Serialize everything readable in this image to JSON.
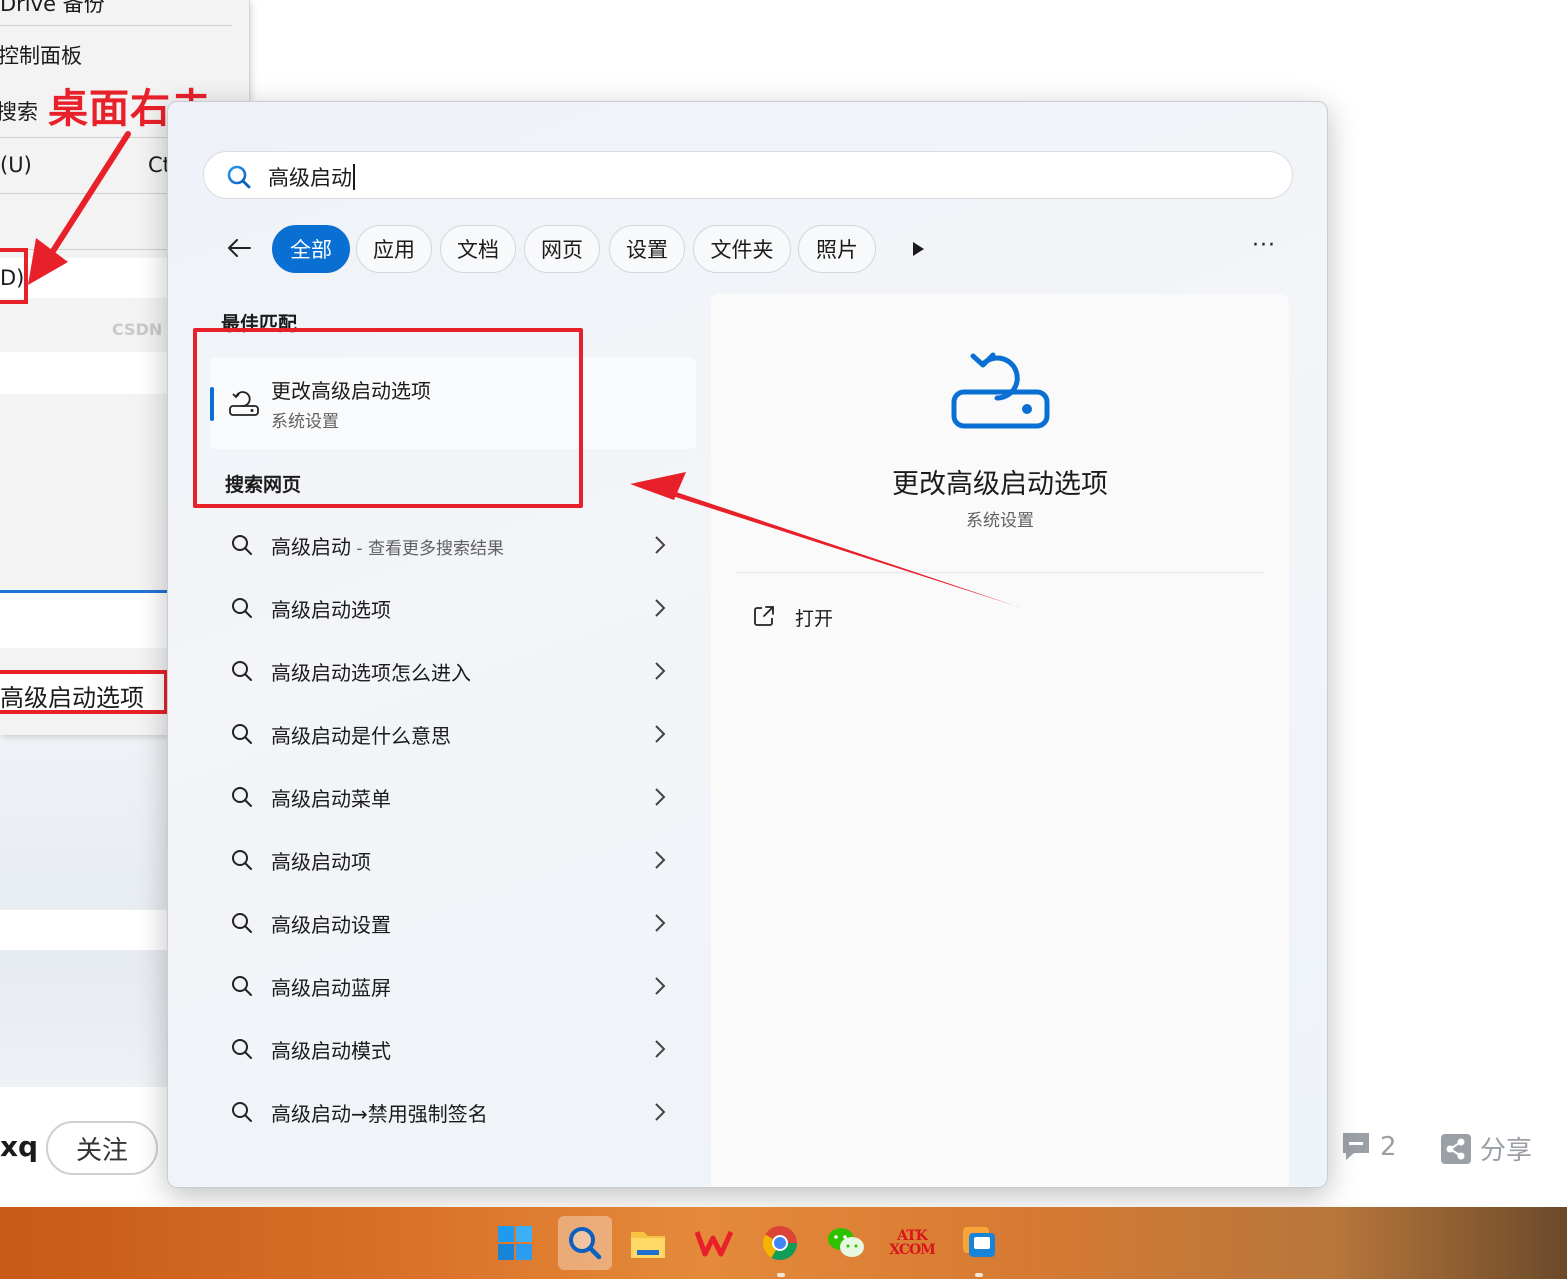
{
  "background": {
    "menu_items": {
      "drive": "Drive 备份",
      "control_panel": "控制面板",
      "search": "搜索",
      "u_item": "(U)",
      "u_shortcut": "Ct",
      "d_item": "D)",
      "highlighted": "高级启动选项"
    },
    "annotation_text": "桌面右击",
    "watermark": "CSDN",
    "author_suffix": "xq",
    "follow_label": "关注",
    "comment_count": "2",
    "share_label": "分享"
  },
  "search": {
    "query": "高级启动",
    "filters": [
      {
        "label": "全部",
        "active": true
      },
      {
        "label": "应用",
        "active": false
      },
      {
        "label": "文档",
        "active": false
      },
      {
        "label": "网页",
        "active": false
      },
      {
        "label": "设置",
        "active": false
      },
      {
        "label": "文件夹",
        "active": false
      },
      {
        "label": "照片",
        "active": false
      }
    ],
    "more_label": "···",
    "best_match_heading": "最佳匹配",
    "best_match": {
      "title": "更改高级启动选项",
      "subtitle": "系统设置"
    },
    "web_heading": "搜索网页",
    "web_results": [
      {
        "text": "高级启动",
        "hint": " - 查看更多搜索结果"
      },
      {
        "text": "高级启动选项",
        "hint": ""
      },
      {
        "text": "高级启动选项怎么进入",
        "hint": ""
      },
      {
        "text": "高级启动是什么意思",
        "hint": ""
      },
      {
        "text": "高级启动菜单",
        "hint": ""
      },
      {
        "text": "高级启动项",
        "hint": ""
      },
      {
        "text": "高级启动设置",
        "hint": ""
      },
      {
        "text": "高级启动蓝屏",
        "hint": ""
      },
      {
        "text": "高级启动模式",
        "hint": ""
      },
      {
        "text": "高级启动→禁用强制签名",
        "hint": ""
      }
    ],
    "preview": {
      "title": "更改高级启动选项",
      "subtitle": "系统设置",
      "open_label": "打开"
    }
  },
  "colors": {
    "accent": "#0a6fd2",
    "annotation": "#e8202a"
  },
  "taskbar": {
    "icons": [
      "windows-start-icon",
      "search-icon",
      "file-explorer-icon",
      "wps-icon",
      "chrome-icon",
      "wechat-icon",
      "atk-xcom-icon",
      "remote-app-icon"
    ],
    "atk_label_top": "ATK",
    "atk_label_bottom": "XCOM"
  }
}
